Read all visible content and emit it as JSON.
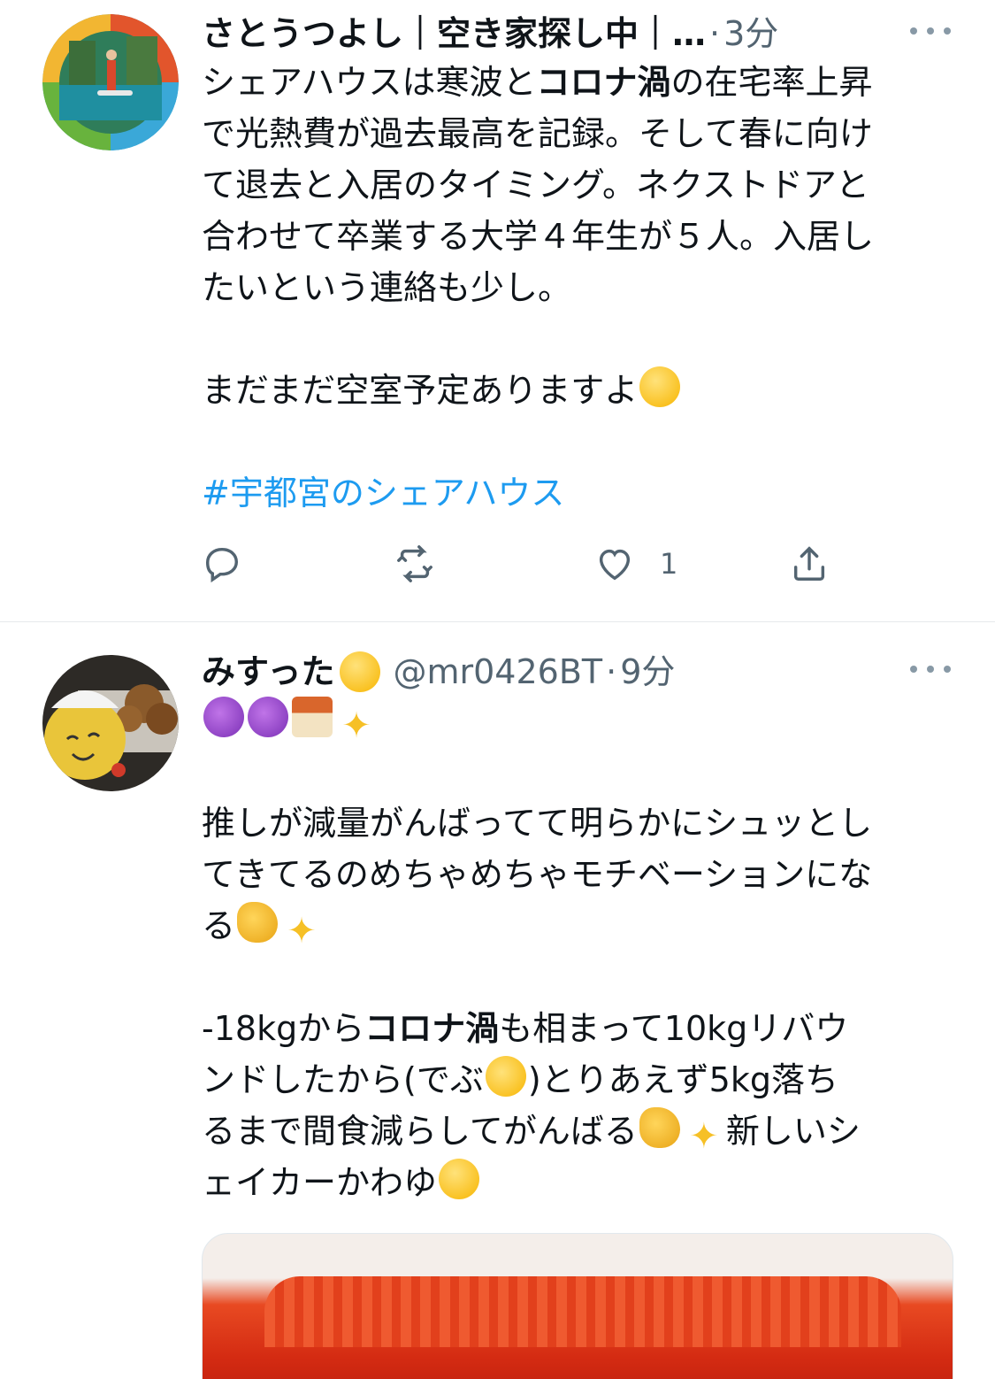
{
  "tweets": [
    {
      "name": "さとうつよし｜空き家探し中｜…",
      "handle": "",
      "time": "3分",
      "lines": [
        {
          "parts": [
            {
              "t": "シェアハウスは寒波と"
            },
            {
              "t": "コロナ渦",
              "b": true
            },
            {
              "t": "の在宅率上昇"
            }
          ]
        },
        {
          "parts": [
            {
              "t": "で光熱費が過去最高を記録。そして春に向け"
            }
          ]
        },
        {
          "parts": [
            {
              "t": "て退去と入居のタイミング。ネクストドアと"
            }
          ]
        },
        {
          "parts": [
            {
              "t": "合わせて卒業する大学４年生が５人。入居し"
            }
          ]
        },
        {
          "parts": [
            {
              "t": "たいという連絡も少し。"
            }
          ]
        },
        {
          "parts": [
            {
              "t": ""
            }
          ]
        },
        {
          "parts": [
            {
              "t": "まだまだ空室予定ありますよ"
            },
            {
              "emoji": "laugh-emoji"
            }
          ]
        },
        {
          "parts": [
            {
              "t": ""
            }
          ]
        },
        {
          "parts": [
            {
              "t": "#宇都宮のシェアハウス",
              "h": true
            }
          ]
        }
      ],
      "actions": {
        "reply_icon": "reply-icon",
        "retweet_icon": "retweet-icon",
        "like_icon": "like-icon",
        "like_count": "1",
        "share_icon": "share-icon"
      }
    },
    {
      "name": "みすった",
      "handle": "@mr0426BT",
      "time": "9分",
      "lines": [
        {
          "parts": [
            {
              "emoji": "devil-emoji"
            },
            {
              "emoji": "devil-emoji"
            },
            {
              "emoji": "house-emoji"
            },
            {
              "emoji": "sparkles-emoji"
            }
          ]
        },
        {
          "parts": [
            {
              "t": ""
            }
          ]
        },
        {
          "parts": [
            {
              "t": "推しが減量がんばってて明らかにシュッとし"
            }
          ]
        },
        {
          "parts": [
            {
              "t": "てきてるのめちゃめちゃモチベーションにな"
            }
          ]
        },
        {
          "parts": [
            {
              "t": "る"
            },
            {
              "emoji": "muscle-emoji"
            },
            {
              "emoji": "sparkles-emoji"
            }
          ]
        },
        {
          "parts": [
            {
              "t": ""
            }
          ]
        },
        {
          "parts": [
            {
              "t": "-18kgから"
            },
            {
              "t": "コロナ渦",
              "b": true
            },
            {
              "t": "も相まって10kgリバウ"
            }
          ]
        },
        {
          "parts": [
            {
              "t": "ンドしたから(でぶ"
            },
            {
              "emoji": "halo-emoji"
            },
            {
              "t": ")とりあえず5kg落ち"
            }
          ]
        },
        {
          "parts": [
            {
              "t": "るまで間食減らしてがんばる"
            },
            {
              "emoji": "muscle-emoji"
            },
            {
              "emoji": "sparkles-emoji"
            },
            {
              "t": "新しいシ"
            }
          ]
        },
        {
          "parts": [
            {
              "t": "ェイカーかわゆ"
            },
            {
              "emoji": "love-emoji"
            }
          ]
        }
      ],
      "media": "red-shaker-photo"
    }
  ],
  "colors": {
    "accent": "#1d9bf0",
    "secondary_text": "#536471",
    "divider": "#e6e9ec"
  }
}
